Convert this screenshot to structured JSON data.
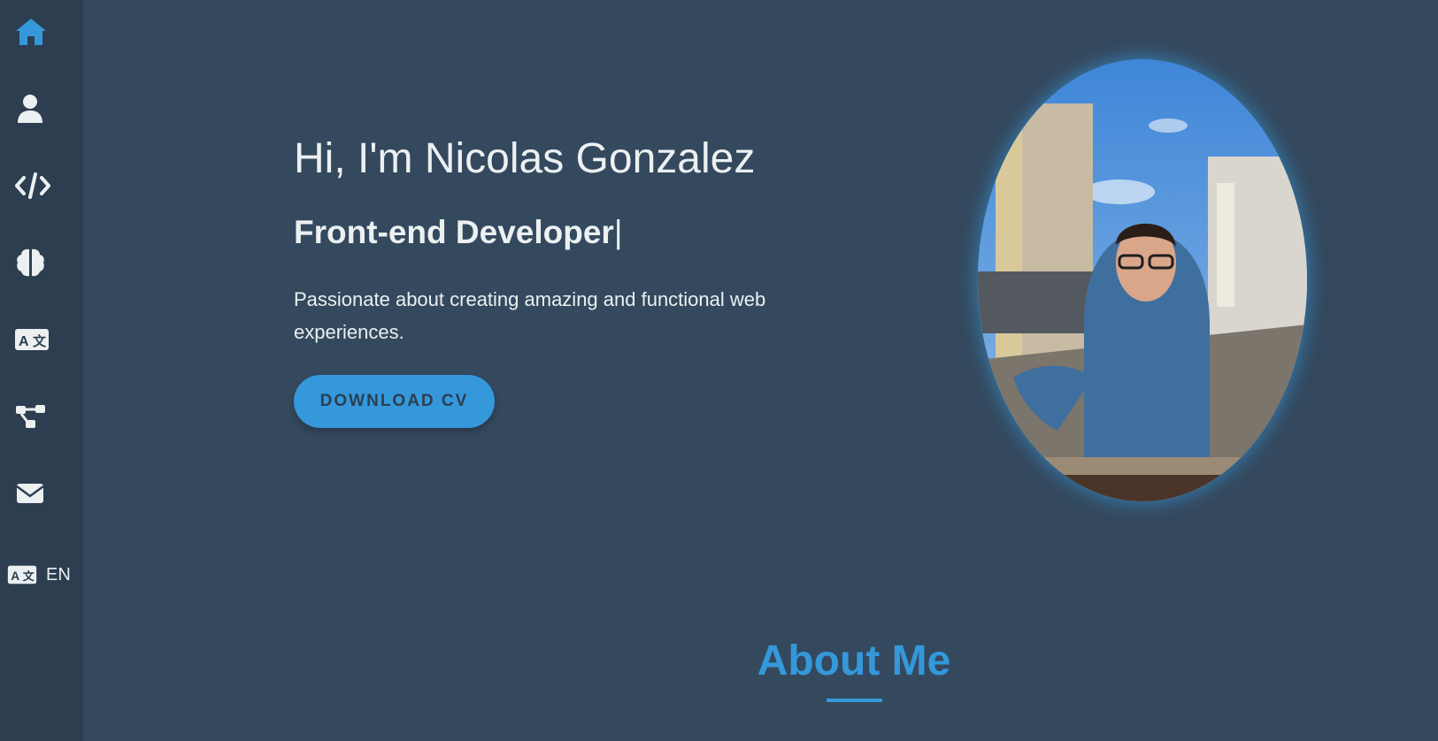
{
  "sidebar": {
    "items": [
      {
        "name": "home",
        "icon": "home-icon",
        "color": "#3498db"
      },
      {
        "name": "about",
        "icon": "user-icon",
        "color": "#ecf0f1"
      },
      {
        "name": "projects",
        "icon": "code-icon",
        "color": "#ecf0f1"
      },
      {
        "name": "skills",
        "icon": "brain-icon",
        "color": "#ecf0f1"
      },
      {
        "name": "languages",
        "icon": "translate-icon",
        "color": "#ecf0f1"
      },
      {
        "name": "experience",
        "icon": "sitemap-icon",
        "color": "#ecf0f1"
      },
      {
        "name": "contact",
        "icon": "envelope-icon",
        "color": "#ecf0f1"
      }
    ],
    "language": {
      "icon": "translate-icon",
      "code": "EN"
    }
  },
  "hero": {
    "title": "Hi, I'm Nicolas Gonzalez",
    "role": "Front-end Developer",
    "caret": "|",
    "description": "Passionate about creating amazing and functional web experiences.",
    "cv_button": "DOWNLOAD CV"
  },
  "about": {
    "title": "About Me"
  },
  "colors": {
    "background": "#34495e",
    "sidebar": "#2c3e50",
    "accent": "#3498db",
    "text": "#ecf0f1"
  }
}
